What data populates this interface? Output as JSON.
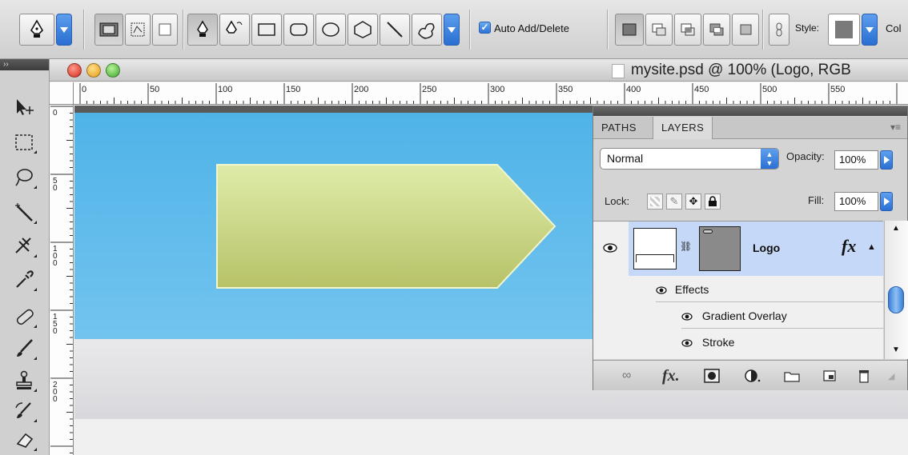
{
  "options_bar": {
    "auto_add_delete_label": "Auto Add/Delete",
    "auto_add_delete_checked": true,
    "style_label": "Style:",
    "color_label_partial": "Col"
  },
  "document": {
    "title": "mysite.psd @ 100% (Logo, RGB",
    "ruler_h_labels": [
      "0",
      "50",
      "100",
      "150",
      "200",
      "250",
      "300",
      "350",
      "400",
      "450",
      "500",
      "550"
    ],
    "ruler_v_labels": [
      "0",
      "50",
      "100",
      "150",
      "200"
    ]
  },
  "layers_panel": {
    "tabs": [
      "PATHS",
      "LAYERS"
    ],
    "active_tab": "LAYERS",
    "blend_mode": "Normal",
    "opacity_label": "Opacity:",
    "opacity_value": "100%",
    "lock_label": "Lock:",
    "fill_label": "Fill:",
    "fill_value": "100%",
    "layer": {
      "name": "Logo",
      "fx": "fx"
    },
    "effects_label": "Effects",
    "effects": [
      "Gradient Overlay",
      "Stroke"
    ]
  },
  "colors": {
    "sky_top": "#4fb3e8",
    "logo_fill_top": "#dbe8a8",
    "logo_fill_bottom": "#b9c46a",
    "selection_blue": "#c5d8f7",
    "aqua_button": "#2b70d3"
  }
}
